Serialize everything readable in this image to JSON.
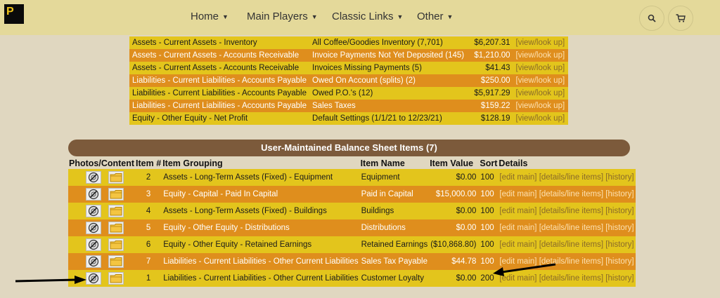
{
  "nav": {
    "items": [
      {
        "label": "Home"
      },
      {
        "label": "Main Players"
      },
      {
        "label": "Classic Links"
      },
      {
        "label": "Other"
      }
    ]
  },
  "top_rows": [
    {
      "account": "Assets - Current Assets - Inventory",
      "desc": "All Coffee/Goodies Inventory (7,701)",
      "amount": "$6,207.31",
      "link": "[view/look up]",
      "style": "y"
    },
    {
      "account": "Assets - Current Assets - Accounts Receivable",
      "desc": "Invoice Payments Not Yet Deposited (145)",
      "amount": "$1,210.00",
      "link": "[view/look up]",
      "style": "o"
    },
    {
      "account": "Assets - Current Assets - Accounts Receivable",
      "desc": "Invoices Missing Payments (5)",
      "amount": "$41.43",
      "link": "[view/look up]",
      "style": "y"
    },
    {
      "account": "Liabilities - Current Liabilities - Accounts Payable",
      "desc": "Owed On Account (splits) (2)",
      "amount": "$250.00",
      "link": "[view/look up]",
      "style": "o"
    },
    {
      "account": "Liabilities - Current Liabilities - Accounts Payable",
      "desc": "Owed P.O.'s (12)",
      "amount": "$5,917.29",
      "link": "[view/look up]",
      "style": "y"
    },
    {
      "account": "Liabilities - Current Liabilities - Accounts Payable",
      "desc": "Sales Taxes",
      "amount": "$159.22",
      "link": "[view/look up]",
      "style": "o"
    },
    {
      "account": "Equity - Other Equity - Net Profit",
      "desc": "Default Settings (1/1/21 to 12/23/21)",
      "amount": "$128.19",
      "link": "[view/look up]",
      "style": "y"
    }
  ],
  "panel": {
    "title": "User-Maintained Balance Sheet Items (7)",
    "columns": {
      "photos": "Photos/Content",
      "item_no": "Item #",
      "grouping": "Item Grouping",
      "name": "Item Name",
      "value": "Item Value",
      "sort": "Sort",
      "details": "Details"
    },
    "rows": [
      {
        "no": "2",
        "grouping": "Assets - Long-Term Assets (Fixed) - Equipment",
        "name": "Equipment",
        "value": "$0.00",
        "sort": "100",
        "style": "y"
      },
      {
        "no": "3",
        "grouping": "Equity - Capital - Paid In Capital",
        "name": "Paid in Capital",
        "value": "$15,000.00",
        "sort": "100",
        "style": "o"
      },
      {
        "no": "4",
        "grouping": "Assets - Long-Term Assets (Fixed) - Buildings",
        "name": "Buildings",
        "value": "$0.00",
        "sort": "100",
        "style": "y"
      },
      {
        "no": "5",
        "grouping": "Equity - Other Equity - Distributions",
        "name": "Distributions",
        "value": "$0.00",
        "sort": "100",
        "style": "o"
      },
      {
        "no": "6",
        "grouping": "Equity - Other Equity - Retained Earnings",
        "name": "Retained Earnings",
        "value": "($10,868.80)",
        "sort": "100",
        "style": "y"
      },
      {
        "no": "7",
        "grouping": "Liabilities - Current Liabilities - Other Current Liabilities",
        "name": "Sales Tax Payable",
        "value": "$44.78",
        "sort": "100",
        "style": "o"
      },
      {
        "no": "1",
        "grouping": "Liabilities - Current Liabilities - Other Current Liabilities",
        "name": "Customer Loyalty",
        "value": "$0.00",
        "sort": "200",
        "style": "y"
      }
    ],
    "actions": {
      "edit": "[edit main]",
      "details": "[details/line items]",
      "history": "[history]"
    }
  },
  "icons": {
    "logo": "logo-icon",
    "search": "search-icon",
    "cart": "cart-icon",
    "photo": "no-photo-icon",
    "folder": "folder-icon"
  },
  "colors": {
    "header_bg": "#e4d99a",
    "page_bg": "#e0d7c0",
    "row_yellow": "#e3c51c",
    "row_orange": "#df8e1d",
    "panel_header": "#7c5a3b"
  }
}
